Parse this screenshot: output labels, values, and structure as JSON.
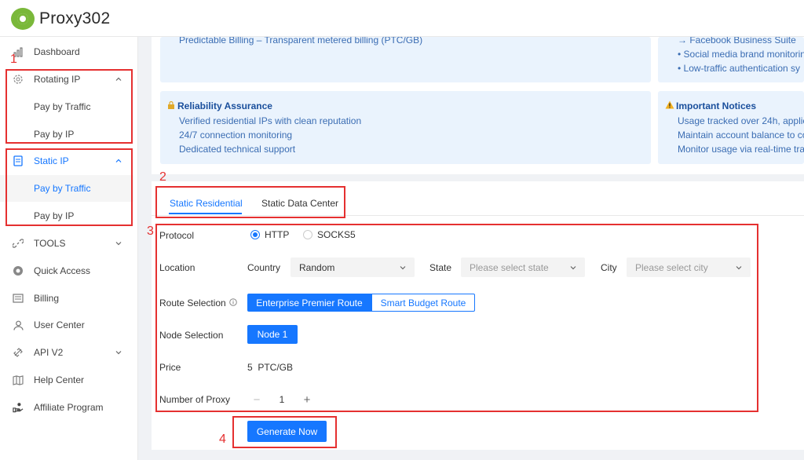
{
  "app": {
    "name": "Proxy302"
  },
  "sidebar": {
    "items": [
      {
        "label": "Dashboard",
        "icon": "chart-icon"
      },
      {
        "label": "Rotating IP",
        "icon": "gear-icon"
      },
      {
        "label": "Pay by Traffic"
      },
      {
        "label": "Pay by IP"
      },
      {
        "label": "Static IP",
        "icon": "server-icon"
      },
      {
        "label": "Pay by Traffic"
      },
      {
        "label": "Pay by IP"
      },
      {
        "label": "TOOLS",
        "icon": "link-icon"
      },
      {
        "label": "Quick Access",
        "icon": "chrome-icon"
      },
      {
        "label": "Billing",
        "icon": "billing-icon"
      },
      {
        "label": "User Center",
        "icon": "user-icon"
      },
      {
        "label": "API V2",
        "icon": "api-icon"
      },
      {
        "label": "Help Center",
        "icon": "book-icon"
      },
      {
        "label": "Affiliate Program",
        "icon": "hand-icon"
      }
    ]
  },
  "annotations": {
    "n1": "1",
    "n2": "2",
    "n3": "3",
    "n4": "4"
  },
  "info": {
    "billing_line": "Predictable Billing – Transparent metered billing (PTC/GB)",
    "use_cases": [
      "→ Facebook Business Suite",
      "• Social media brand monitorin",
      "• Low-traffic authentication sy"
    ],
    "reliability": {
      "title": "Reliability Assurance",
      "lines": [
        "Verified residential IPs with clean reputation",
        "24/7 connection monitoring",
        "Dedicated technical support"
      ]
    },
    "notices": {
      "title": "Important Notices",
      "lines": [
        "Usage tracked over 24h, applie",
        "Maintain account balance to co",
        "Monitor usage via real-time tra"
      ]
    }
  },
  "tabs": [
    "Static Residential",
    "Static Data Center"
  ],
  "form": {
    "protocol": {
      "label": "Protocol",
      "options": [
        "HTTP",
        "SOCKS5"
      ],
      "selected": "HTTP"
    },
    "location": {
      "label": "Location",
      "country_label": "Country",
      "country_value": "Random",
      "state_label": "State",
      "state_placeholder": "Please select state",
      "city_label": "City",
      "city_placeholder": "Please select city"
    },
    "route": {
      "label": "Route Selection",
      "options": [
        "Enterprise Premier Route",
        "Smart Budget Route"
      ],
      "selected": "Enterprise Premier Route"
    },
    "node": {
      "label": "Node Selection",
      "value": "Node 1"
    },
    "price": {
      "label": "Price",
      "value": "5  PTC/GB"
    },
    "quantity": {
      "label": "Number of Proxy",
      "value": "1",
      "minus": "−",
      "plus": "+"
    },
    "submit": "Generate Now"
  },
  "colors": {
    "accent": "#1677ff",
    "annotation": "#e53030",
    "brand": "#7ab83a"
  }
}
